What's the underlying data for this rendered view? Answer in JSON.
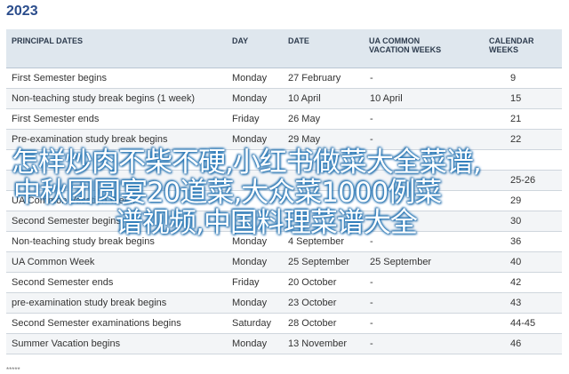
{
  "year": "2023",
  "headers": {
    "principal": "PRINCIPAL DATES",
    "day": "DAY",
    "date": "DATE",
    "ua_line1": "UA COMMON",
    "ua_line2": "VACATION WEEKS",
    "cal_line1": "CALENDAR",
    "cal_line2": "WEEKS"
  },
  "rows": [
    {
      "name": "First Semester begins",
      "day": "Monday",
      "date": "27 February",
      "ua": "-",
      "cal": "9"
    },
    {
      "name": "Non-teaching study break begins (1 week)",
      "day": "Monday",
      "date": "10 April",
      "ua": "10 April",
      "cal": "15"
    },
    {
      "name": "First Semester ends",
      "day": "Friday",
      "date": "26 May",
      "ua": "-",
      "cal": "21"
    },
    {
      "name": "Pre-examination study break begins",
      "day": "Monday",
      "date": "29 May",
      "ua": "-",
      "cal": "22"
    },
    {
      "name": "",
      "day": "",
      "date": "",
      "ua": "",
      "cal": ""
    },
    {
      "name": "",
      "day": "",
      "date": "",
      "ua": "",
      "cal": "25-26"
    },
    {
      "name": "UA Common Vacation Week",
      "day": "",
      "date": "",
      "ua": "",
      "cal": "29"
    },
    {
      "name": "Second Semester begins",
      "day": "",
      "date": "",
      "ua": "",
      "cal": "30"
    },
    {
      "name": "Non-teaching study break begins",
      "day": "Monday",
      "date": "4 September",
      "ua": "-",
      "cal": "36"
    },
    {
      "name": "UA Common Week",
      "day": "Monday",
      "date": "25 September",
      "ua": "25 September",
      "cal": "40"
    },
    {
      "name": "Second Semester ends",
      "day": "Friday",
      "date": "20 October",
      "ua": "-",
      "cal": "42"
    },
    {
      "name": "pre-examination study break begins",
      "day": "Monday",
      "date": "23 October",
      "ua": "-",
      "cal": "43"
    },
    {
      "name": "Second Semester examinations begins",
      "day": "Saturday",
      "date": "28 October",
      "ua": "-",
      "cal": "44-45"
    },
    {
      "name": "Summer Vacation begins",
      "day": "Monday",
      "date": "13 November",
      "ua": "-",
      "cal": "46"
    }
  ],
  "overlay": {
    "line1": "怎样炒肉不柴不硬,小红书做菜大全菜谱,",
    "line2": "中秋团圆宴20道菜,大众菜1000例菜",
    "line3": "谱视频,中国料理菜谱大全"
  },
  "footer": "*****"
}
